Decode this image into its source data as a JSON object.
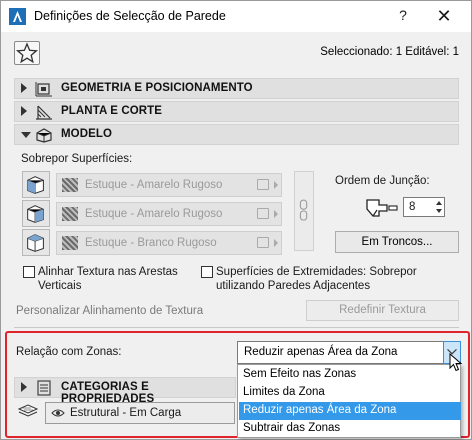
{
  "window": {
    "title": "Definições de Selecção de Parede",
    "help_label": "?",
    "close_label": "✕"
  },
  "header": {
    "selected_info": "Seleccionado: 1 Editável: 1"
  },
  "sections": [
    {
      "label": "GEOMETRIA E POSICIONAMENTO",
      "expanded": false,
      "icon": "geometry-icon"
    },
    {
      "label": "PLANTA E CORTE",
      "expanded": false,
      "icon": "floorplan-icon"
    },
    {
      "label": "MODELO",
      "expanded": true,
      "icon": "model-icon"
    },
    {
      "label": "CATEGORIAS E PROPRIEDADES",
      "expanded": false,
      "icon": "categories-icon"
    }
  ],
  "model": {
    "override_label": "Sobrepor Superfícies:",
    "surfaces": [
      {
        "name": "Estuque - Amarelo Rugoso",
        "icon": "wall-outside-face-icon"
      },
      {
        "name": "Estuque - Amarelo Rugoso",
        "icon": "wall-edge-face-icon"
      },
      {
        "name": "Estuque - Branco Rugoso",
        "icon": "wall-inside-face-icon"
      }
    ],
    "join_order_label": "Ordem de Junção:",
    "join_order_value": "8",
    "trunks_button": "Em Troncos...",
    "align_texture_label": "Alinhar Textura nas Arestas Verticais",
    "end_surfaces_label": "Superfícies de Extremidades: Sobrepor utilizando Paredes Adjacentes",
    "custom_align_label": "Personalizar Alinhamento de Textura",
    "reset_texture_button": "Redefinir Textura"
  },
  "zones": {
    "label": "Relação com Zonas:",
    "selected": "Reduzir apenas Área da Zona",
    "options": [
      "Sem Efeito nas Zonas",
      "Limites da Zona",
      "Reduzir apenas Área da Zona",
      "Subtrair das Zonas"
    ],
    "highlighted_index": 2
  },
  "layer": {
    "name": "Estrutural - Em Carga"
  },
  "colors": {
    "highlight": "#3399e8",
    "annotation_red": "#e0242b",
    "section_bg": "#e0e0e0"
  }
}
